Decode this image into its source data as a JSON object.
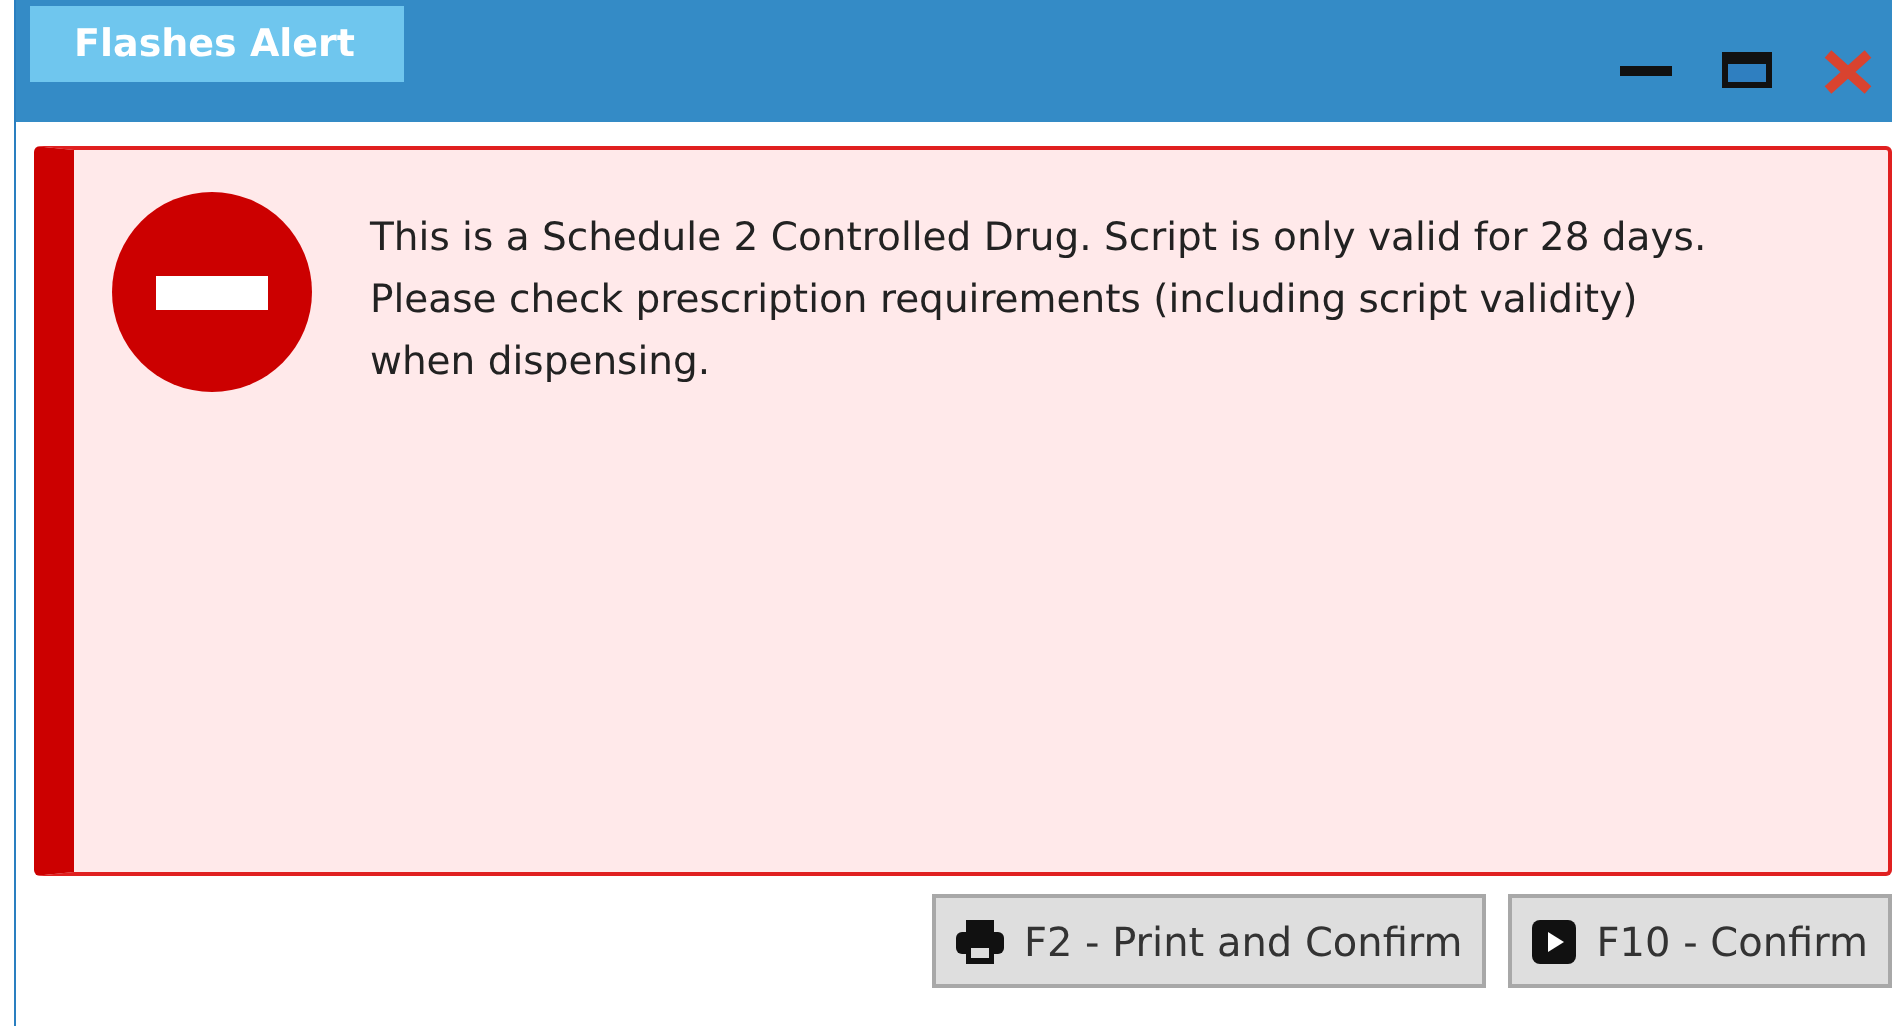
{
  "window": {
    "title": "Flashes Alert"
  },
  "alert": {
    "kind": "stop",
    "message": "This is a Schedule 2 Controlled Drug. Script is only valid for 28 days. Please check prescription requirements (including script validity) when dispensing."
  },
  "buttons": [
    {
      "label": "F2 - Print and Confirm",
      "kind": "print"
    },
    {
      "label": "F10 - Confirm",
      "kind": "play"
    }
  ]
}
